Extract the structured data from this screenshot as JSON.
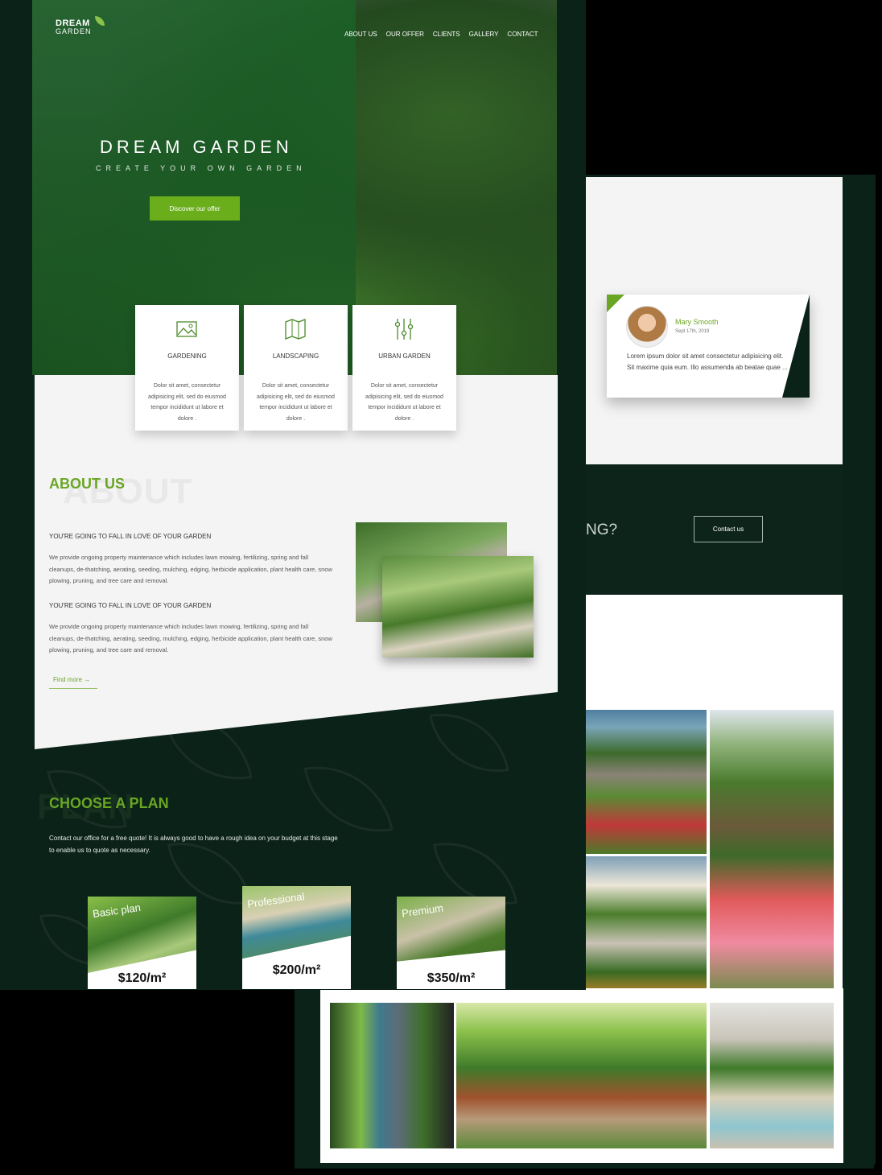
{
  "brand": {
    "line1": "DREAM",
    "line2": "GARDEN"
  },
  "nav": [
    "ABOUT US",
    "OUR OFFER",
    "CLIENTS",
    "GALLERY",
    "CONTACT"
  ],
  "hero": {
    "title": "DREAM GARDEN",
    "tagline": "CREATE YOUR OWN GARDEN",
    "cta": "Discover our offer"
  },
  "services": [
    {
      "label": "GARDENING",
      "icon": "image-icon",
      "text": "Dolor sit amet, consectetur adipisicing elit, sed do eiusmod tempor incididunt ut labore et dolore ."
    },
    {
      "label": "LANDSCAPING",
      "icon": "map-icon",
      "text": "Dolor sit amet, consectetur adipisicing elit, sed do eiusmod tempor incididunt ut labore et dolore ."
    },
    {
      "label": "URBAN GARDEN",
      "icon": "sliders-icon",
      "text": "Dolor sit amet, consectetur adipisicing elit, sed do eiusmod tempor incididunt ut labore et dolore ."
    }
  ],
  "about": {
    "title": "ABOUT US",
    "ghost": "ABOUT",
    "blocks": [
      {
        "heading": "YOU'RE GOING TO FALL IN LOVE OF YOUR GARDEN",
        "text": "We provide ongoing property maintenance which includes lawn mowing, fertilizing, spring and fall cleanups, de-thatching, aerating, seeding, mulching, edging, herbicide application, plant health care, snow plowing, pruning, and tree care and removal."
      },
      {
        "heading": "YOU'RE GOING TO FALL IN LOVE OF YOUR GARDEN",
        "text": "We provide ongoing property maintenance which includes lawn mowing, fertilizing, spring and fall cleanups, de-thatching, aerating, seeding, mulching, edging, herbicide application, plant health care, snow plowing, pruning, and tree care and removal."
      }
    ],
    "link": "Find more →"
  },
  "plans": {
    "title": "CHOOSE A PLAN",
    "ghost": "PLAN",
    "text": "Contact our office for a free quote! It is always good to have a rough idea on your budget at this stage to enable us to quote as necessary.",
    "items": [
      {
        "name": "Basic plan",
        "price": "$120/m²"
      },
      {
        "name": "Professional",
        "price": "$200/m²"
      },
      {
        "name": "Premium",
        "price": "$350/m²"
      }
    ]
  },
  "testimonial": {
    "name": "Mary Smooth",
    "date": "Sept 17th, 2019",
    "text": "Lorem ipsum dolor sit amet consectetur adipisicing elit. Sit maxime quia eum. Illo assumenda ab beatae quae ..."
  },
  "cta_band": {
    "partial_text": "NG?",
    "button": "Contact us"
  },
  "colors": {
    "accent": "#6aa624",
    "dark": "#0b2218",
    "button": "#6aae1c"
  }
}
